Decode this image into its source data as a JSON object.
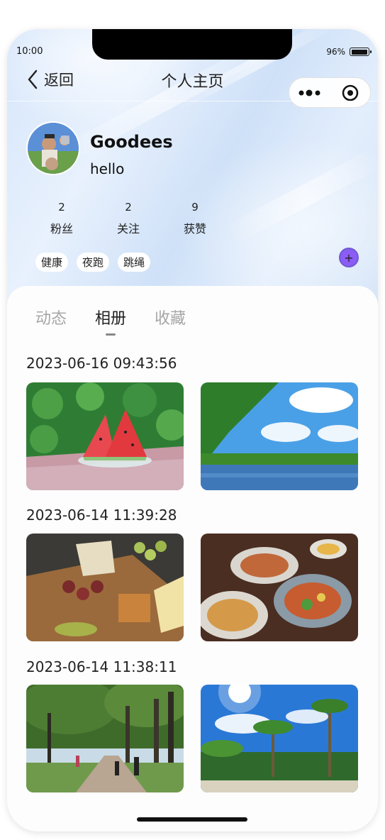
{
  "status_bar": {
    "time": "10:00",
    "battery_text": "96%",
    "battery_level": 0.96
  },
  "nav": {
    "back_label": "返回",
    "title": "个人主页"
  },
  "profile": {
    "username": "Goodees",
    "bio": "hello"
  },
  "stats": [
    {
      "value": "2",
      "label": "粉丝"
    },
    {
      "value": "2",
      "label": "关注"
    },
    {
      "value": "9",
      "label": "获赞"
    }
  ],
  "tags": [
    "健康",
    "夜跑",
    "跳绳"
  ],
  "add_tag_symbol": "+",
  "tabs": [
    {
      "label": "动态",
      "active": false
    },
    {
      "label": "相册",
      "active": true
    },
    {
      "label": "收藏",
      "active": false
    }
  ],
  "album": [
    {
      "date": "2023-06-16 09:43:56",
      "photos": [
        "watermelon-photo",
        "river-photo"
      ]
    },
    {
      "date": "2023-06-14 11:39:28",
      "photos": [
        "charcuterie-photo",
        "seafood-platter-photo"
      ]
    },
    {
      "date": "2023-06-14 11:38:11",
      "photos": [
        "park-runners-photo",
        "palm-beach-photo"
      ]
    }
  ],
  "colors": {
    "accent_purple": "#8b5cf6",
    "active_tab": "#222222",
    "inactive_tab": "#a6a6a6"
  }
}
